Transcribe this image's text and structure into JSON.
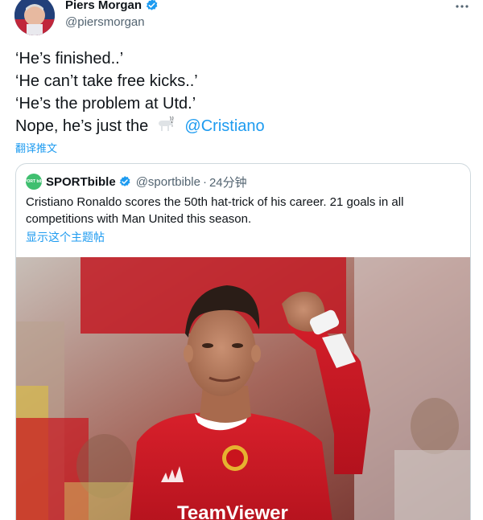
{
  "tweet": {
    "author": {
      "display_name": "Piers Morgan",
      "handle": "@piersmorgan",
      "verified": true
    },
    "lines": [
      "‘He’s finished..’",
      "‘He can’t take free kicks..’",
      "‘He’s the problem at Utd.’"
    ],
    "last_line_prefix": "Nope, he’s just the",
    "emoji_icon": "goat-icon",
    "mention": "@Cristiano",
    "translate_label": "翻译推文"
  },
  "quote": {
    "avatar_text": "SPORT bible",
    "display_name": "SPORTbible",
    "handle": "@sportbible",
    "separator": "·",
    "time": "24分钟",
    "text": "Cristiano Ronaldo scores the 50th hat-trick of his career. 21 goals in all competitions with Man United this season.",
    "show_thread": "显示这个主题帖",
    "shirt_sponsor": "TeamViewer"
  },
  "colors": {
    "link": "#1d9bf0",
    "text": "#0f1419",
    "muted": "#536471",
    "border": "#cfd9de",
    "kit_red": "#d0141f"
  }
}
